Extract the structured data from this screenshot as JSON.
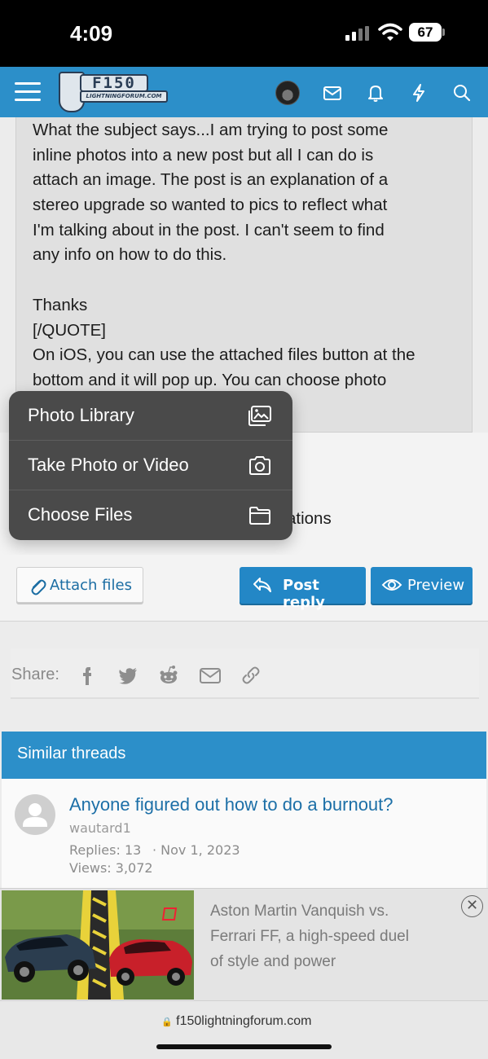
{
  "status_bar": {
    "time": "4:09",
    "battery": "67"
  },
  "header": {
    "logo_top": "F150",
    "logo_bottom": "LIGHTNINGFORUM.COM"
  },
  "quote": {
    "lines": [
      "What the subject says...I am trying to post some",
      "inline photos into a new post but all I can do is",
      "attach an image. The post is an explanation of a",
      "stereo upgrade so wanted to pics to reflect what",
      "I'm talking about in the post. I can't seem to find",
      "any info on how to do this.",
      "",
      "Thanks",
      "[/QUOTE]",
      "On iOS, you can use the attached files button at the",
      "bottom and it will pop up. You can choose photo"
    ],
    "partial_tail": "ations"
  },
  "popup_menu": {
    "items": [
      {
        "label": "Photo Library",
        "icon": "photo-library-icon"
      },
      {
        "label": "Take Photo or Video",
        "icon": "camera-icon"
      },
      {
        "label": "Choose Files",
        "icon": "folder-icon"
      }
    ]
  },
  "buttons": {
    "attach": "Attach files",
    "reply": "Post reply",
    "preview": "Preview"
  },
  "share": {
    "label": "Share:",
    "icons": [
      "facebook-icon",
      "twitter-icon",
      "reddit-icon",
      "email-icon",
      "link-icon"
    ]
  },
  "similar_threads": {
    "heading": "Similar threads",
    "thread": {
      "title": "Anyone figured out how to do a burnout?",
      "author": "wautard1",
      "replies": "Replies: 13",
      "date": "· Nov 1, 2023",
      "views": "Views: 3,072"
    }
  },
  "ad": {
    "lines": [
      "Aston Martin Vanquish vs.",
      "Ferrari FF, a high-speed duel",
      "of style and power"
    ],
    "close": "✕"
  },
  "url_bar": {
    "url": "f150lightningforum.com",
    "lock": "🔒"
  },
  "colors": {
    "brand_blue": "#2c8fc9",
    "button_blue": "#2387c6",
    "link_blue": "#1c6fa7"
  }
}
